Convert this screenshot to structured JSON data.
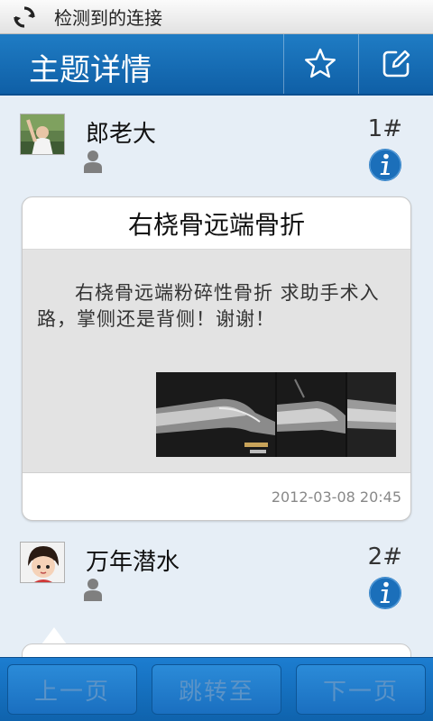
{
  "status_bar": {
    "text": "检测到的连接",
    "icon": "sync-icon"
  },
  "header": {
    "title": "主题详情",
    "actions": [
      {
        "icon": "star-icon"
      },
      {
        "icon": "edit-icon"
      }
    ]
  },
  "posts": [
    {
      "username": "郎老大",
      "floor": "1#",
      "title": "右桡骨远端骨折",
      "body": "右桡骨远端粉碎性骨折 求助手术入路，掌侧还是背侧！谢谢！",
      "timestamp": "2012-03-08 20:45"
    },
    {
      "username": "万年潜水",
      "floor": "2#"
    }
  ],
  "bottom_nav": {
    "prev": "上一页",
    "jump": "跳转至",
    "next": "下一页"
  },
  "colors": {
    "header": "#1569b4",
    "accent": "#1f7cc4",
    "background": "#e6eef6"
  }
}
